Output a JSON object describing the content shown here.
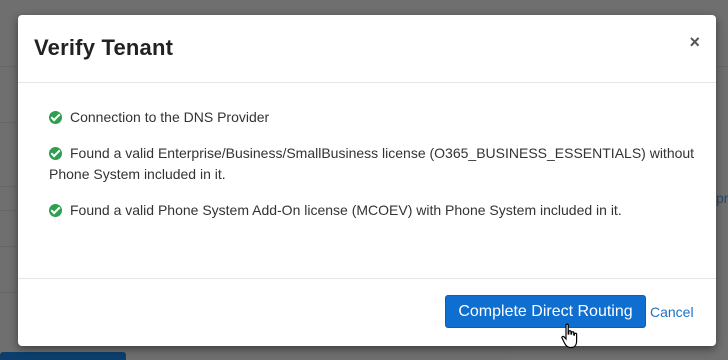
{
  "modal": {
    "title": "Verify Tenant",
    "close_glyph": "×",
    "checks": [
      {
        "text": "Connection to the DNS Provider",
        "status": "success",
        "icon": "check-circle-icon"
      },
      {
        "text": "Found a valid Enterprise/Business/SmallBusiness license (O365_BUSINESS_ESSENTIALS) without Phone System included in it.",
        "status": "success",
        "icon": "check-circle-icon"
      },
      {
        "text": "Found a valid Phone System Add-On license (MCOEV) with Phone System included in it.",
        "status": "success",
        "icon": "check-circle-icon"
      }
    ],
    "primary_button": "Complete Direct Routing",
    "cancel_link": "Cancel"
  },
  "background": {
    "partial_text": "pr"
  },
  "colors": {
    "success": "#2e9e4f",
    "primary": "#0e6fd1",
    "link": "#1a73c8",
    "overlay": "#6f6f6f"
  },
  "cursor": {
    "icon": "hand-pointer-icon"
  }
}
